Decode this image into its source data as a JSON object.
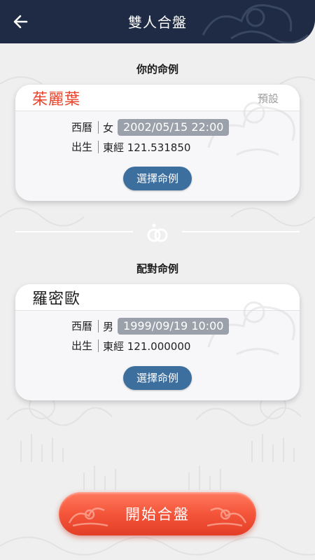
{
  "header": {
    "title": "雙人合盤",
    "back_icon": "arrow-left-icon"
  },
  "my_chart": {
    "section_label": "你的命例",
    "name": "茱麗葉",
    "name_color": "#e8452c",
    "default_tag": "預設",
    "calendar_label": "西曆",
    "gender": "女",
    "datetime": "2002/05/15 22:00",
    "birth_label": "出生",
    "longitude": "東經 121.531850",
    "select_button": "選擇命例"
  },
  "partner_chart": {
    "section_label": "配對命例",
    "name": "羅密歐",
    "name_color": "#1c1c1c",
    "calendar_label": "西曆",
    "gender": "男",
    "datetime": "1999/09/19 10:00",
    "birth_label": "出生",
    "longitude": "東經 121.000000",
    "select_button": "選擇命例"
  },
  "divider_icon": "rings-icon",
  "start_button": {
    "label": "開始合盤"
  },
  "colors": {
    "header_bg": "#1f2b44",
    "accent_blue": "#3c6e9e",
    "start_red": "#f4553a",
    "pill_gray": "#9aa1ab"
  }
}
